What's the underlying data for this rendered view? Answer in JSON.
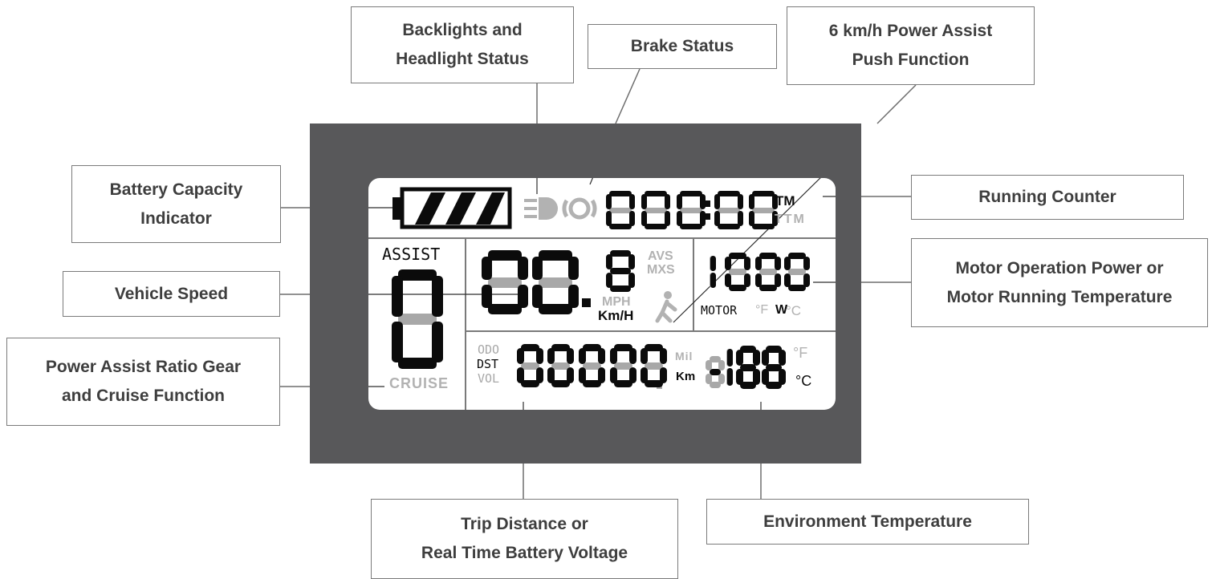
{
  "colors": {
    "panel": "#58585a",
    "lcd_background": "#ffffff",
    "segment_on": "#0b0b0b",
    "segment_off": "#a8a8a8",
    "icon_dim": "#b2b2b2",
    "callout_text": "#3e3e3e",
    "callout_border": "#7a7a7a",
    "leader_line": "#6e6e6e"
  },
  "callouts": {
    "backlights": [
      "Backlights and",
      "Headlight Status"
    ],
    "brake": [
      "Brake Status"
    ],
    "push_assist": [
      "6 km/h Power Assist",
      "Push Function"
    ],
    "battery": [
      "Battery Capacity",
      "Indicator"
    ],
    "running_counter": [
      "Running Counter"
    ],
    "motor_power": [
      "Motor Operation Power or",
      "Motor Running Temperature"
    ],
    "vehicle_speed": [
      "Vehicle Speed"
    ],
    "assist_gear": [
      "Power Assist Ratio Gear",
      "and Cruise Function"
    ],
    "trip_distance": [
      "Trip Distance or",
      "Real Time Battery Voltage"
    ],
    "environment_temp": [
      "Environment Temperature"
    ]
  },
  "display": {
    "battery_icon": "battery-full-icon",
    "headlight_icon": "headlight-icon",
    "brake_icon": "brake-icon",
    "walk_icon": "walking-person-icon",
    "time_digits": "000:00",
    "time_units": {
      "on": "TM",
      "off": "TTM"
    },
    "assist_label": "ASSIST",
    "assist_digit": "8",
    "cruise_label": "CRUISE",
    "speed_digits": "88.",
    "speed_small_digit": "8",
    "speed_modes": [
      "AVS",
      "MXS"
    ],
    "speed_units": {
      "off": "MPH",
      "on": "Km/H"
    },
    "motor_digits": "1888",
    "motor_labels": {
      "motor": "MOTOR",
      "f": "°F",
      "w": "W",
      "c": "°C"
    },
    "trip_modes": {
      "odo": "ODO",
      "dst": "DST",
      "vol": "VOL"
    },
    "trip_digits": "8888.8",
    "trip_units": {
      "mil": "Mil",
      "km": "Km"
    },
    "env_digits": "-188",
    "env_units": {
      "f": "°F",
      "c": "°C"
    }
  }
}
